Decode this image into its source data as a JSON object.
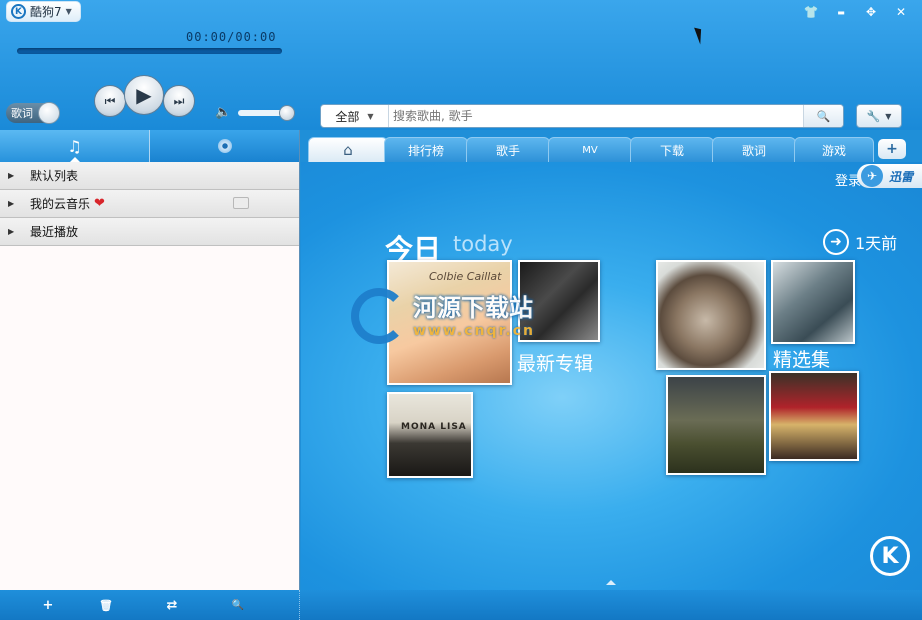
{
  "app": {
    "title": "酷狗7"
  },
  "window": {
    "skin_icon": "tshirt-icon",
    "minimize": "▬",
    "mini_mode": "✥",
    "close": "✕"
  },
  "player": {
    "time": "00:00/00:00",
    "lyrics_toggle": "歌词",
    "prev_icon": "⏮",
    "play_icon": "▶",
    "next_icon": "⏭",
    "volume_icon": "🔈"
  },
  "search": {
    "scope": "全部",
    "placeholder": "搜索歌曲, 歌手",
    "button_icon": "🔍"
  },
  "tools": {
    "icon": "🔧"
  },
  "left_tabs": {
    "music_icon": "♫"
  },
  "playlists": [
    {
      "label": "默认列表"
    },
    {
      "label": "我的云音乐"
    },
    {
      "label": "最近播放"
    }
  ],
  "footer": {
    "add": "+",
    "delete": "🗑",
    "mode": "⇄",
    "find": "🔍"
  },
  "nav_tabs": [
    {
      "label": "⌂"
    },
    {
      "label": "排行榜"
    },
    {
      "label": "歌手"
    },
    {
      "label": "MV"
    },
    {
      "label": "下载"
    },
    {
      "label": "歌词"
    },
    {
      "label": "游戏"
    }
  ],
  "nav_add": "+",
  "content": {
    "login": "登录",
    "xunlei": "迅雷",
    "today_zh": "今日",
    "today_en": "today",
    "day_back": "1天前",
    "album_1_text": "Colbie Caillat",
    "album_3_text": "MONA LISA",
    "newest_albums": "最新专辑",
    "selection": "精选集",
    "watermark_title": "河源下载站",
    "watermark_url": "www.cnqr.cn",
    "k_logo": "K"
  },
  "colors": {
    "accent": "#1f8fd8",
    "heart": "#d8252b"
  }
}
